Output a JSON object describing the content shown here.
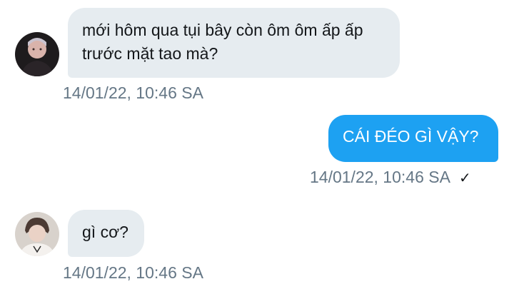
{
  "messages": [
    {
      "direction": "incoming",
      "text": "mới hôm qua tụi bây còn ôm ôm ấp ấp trước mặt tao mà?",
      "timestamp": "14/01/22, 10:46 SA",
      "avatar_icon": "user-avatar-icon"
    },
    {
      "direction": "outgoing",
      "text": "CÁI ĐÉO GÌ VẬY?",
      "timestamp": "14/01/22, 10:46 SA",
      "status_icon": "checkmark-icon",
      "status_glyph": "✓"
    },
    {
      "direction": "incoming",
      "text": "gì cơ?",
      "timestamp": "14/01/22, 10:46 SA",
      "avatar_icon": "user-avatar-icon"
    }
  ],
  "colors": {
    "incoming_bubble": "#e6ecf0",
    "outgoing_bubble": "#1da1f2",
    "timestamp": "#657786"
  }
}
